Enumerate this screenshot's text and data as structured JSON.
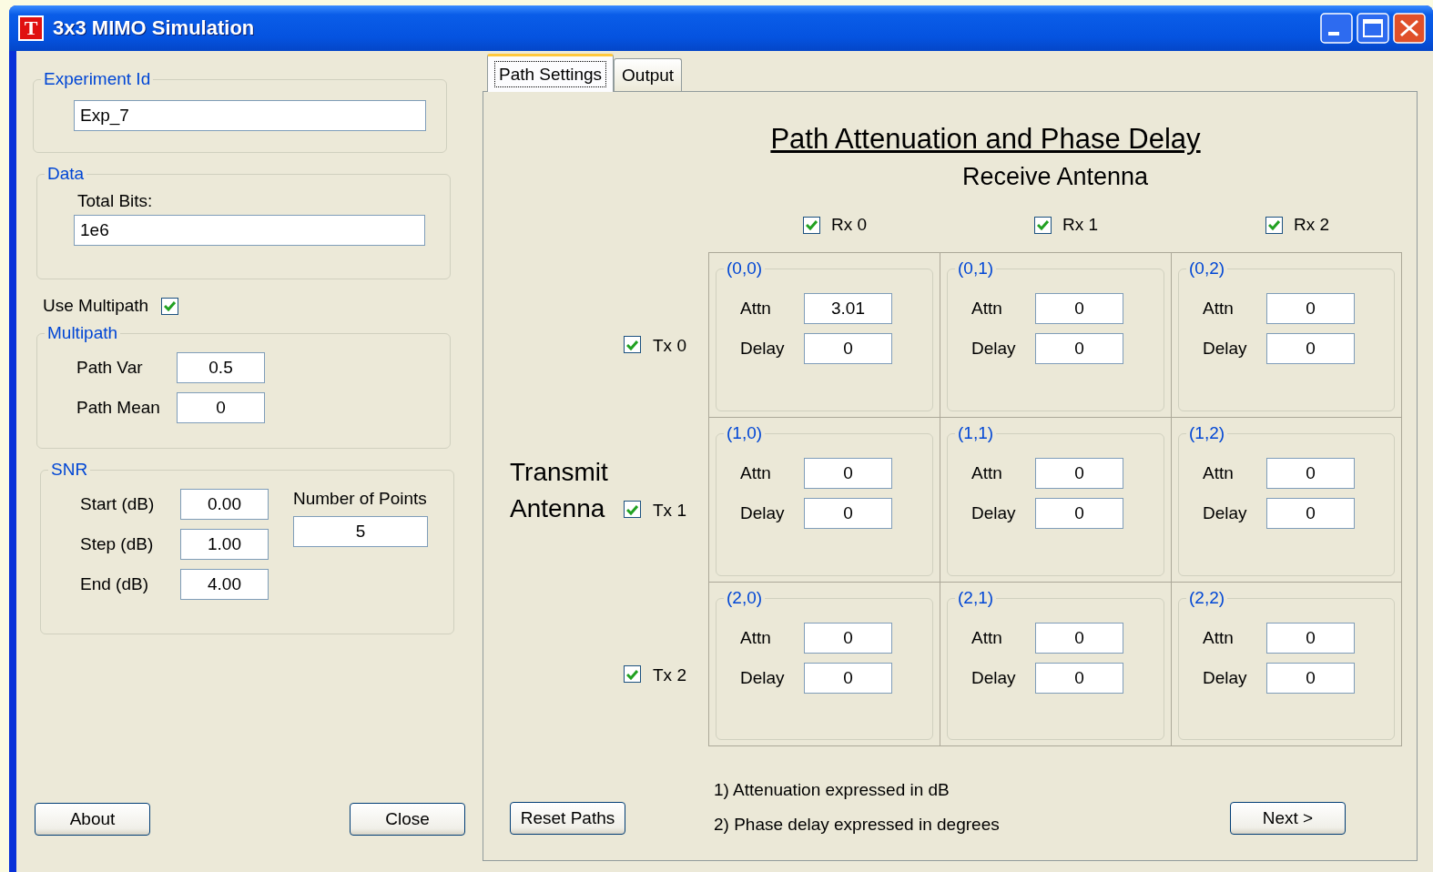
{
  "window": {
    "title": "3x3 MIMO Simulation",
    "icon_letter": "T"
  },
  "experiment": {
    "legend": "Experiment Id",
    "value": "Exp_7"
  },
  "data": {
    "legend": "Data",
    "label": "Total Bits:",
    "value": "1e6"
  },
  "use_multipath": {
    "label": "Use Multipath",
    "checked": true
  },
  "multipath": {
    "legend": "Multipath",
    "fields": [
      {
        "label": "Path Var",
        "value": "0.5"
      },
      {
        "label": "Path Mean",
        "value": "0"
      }
    ]
  },
  "snr": {
    "legend": "SNR",
    "fields": [
      {
        "label": "Start (dB)",
        "value": "0.00"
      },
      {
        "label": "Step (dB)",
        "value": "1.00"
      },
      {
        "label": "End (dB)",
        "value": "4.00"
      }
    ],
    "points": {
      "label": "Number of Points",
      "value": "5"
    }
  },
  "buttons": [
    {
      "label": "About"
    },
    {
      "label": "Close"
    }
  ],
  "tabs": [
    {
      "label": "Path Settings",
      "selected": true
    },
    {
      "label": "Output",
      "selected": false
    }
  ],
  "path_settings": {
    "title": "Path Attenuation and Phase Delay",
    "rx_heading": "Receive Antenna",
    "tx_heading": "Transmit Antenna",
    "rx": [
      {
        "label": "Rx 0",
        "checked": true
      },
      {
        "label": "Rx 1",
        "checked": true
      },
      {
        "label": "Rx 2",
        "checked": true
      }
    ],
    "tx": [
      {
        "label": "Tx 0",
        "checked": true
      },
      {
        "label": "Tx 1",
        "checked": true
      },
      {
        "label": "Tx 2",
        "checked": true
      }
    ],
    "rows": [
      {
        "cells": [
          {
            "legend": "(0,0)",
            "attn_label": "Attn",
            "attn": "3.01",
            "delay_label": "Delay",
            "delay": "0"
          },
          {
            "legend": "(0,1)",
            "attn_label": "Attn",
            "attn": "0",
            "delay_label": "Delay",
            "delay": "0"
          },
          {
            "legend": "(0,2)",
            "attn_label": "Attn",
            "attn": "0",
            "delay_label": "Delay",
            "delay": "0"
          }
        ]
      },
      {
        "cells": [
          {
            "legend": "(1,0)",
            "attn_label": "Attn",
            "attn": "0",
            "delay_label": "Delay",
            "delay": "0"
          },
          {
            "legend": "(1,1)",
            "attn_label": "Attn",
            "attn": "0",
            "delay_label": "Delay",
            "delay": "0"
          },
          {
            "legend": "(1,2)",
            "attn_label": "Attn",
            "attn": "0",
            "delay_label": "Delay",
            "delay": "0"
          }
        ]
      },
      {
        "cells": [
          {
            "legend": "(2,0)",
            "attn_label": "Attn",
            "attn": "0",
            "delay_label": "Delay",
            "delay": "0"
          },
          {
            "legend": "(2,1)",
            "attn_label": "Attn",
            "attn": "0",
            "delay_label": "Delay",
            "delay": "0"
          },
          {
            "legend": "(2,2)",
            "attn_label": "Attn",
            "attn": "0",
            "delay_label": "Delay",
            "delay": "0"
          }
        ]
      }
    ],
    "notes": [
      "1) Attenuation expressed in dB",
      "2) Phase delay expressed in degrees"
    ],
    "reset_button": "Reset Paths",
    "next_button": "Next >"
  }
}
